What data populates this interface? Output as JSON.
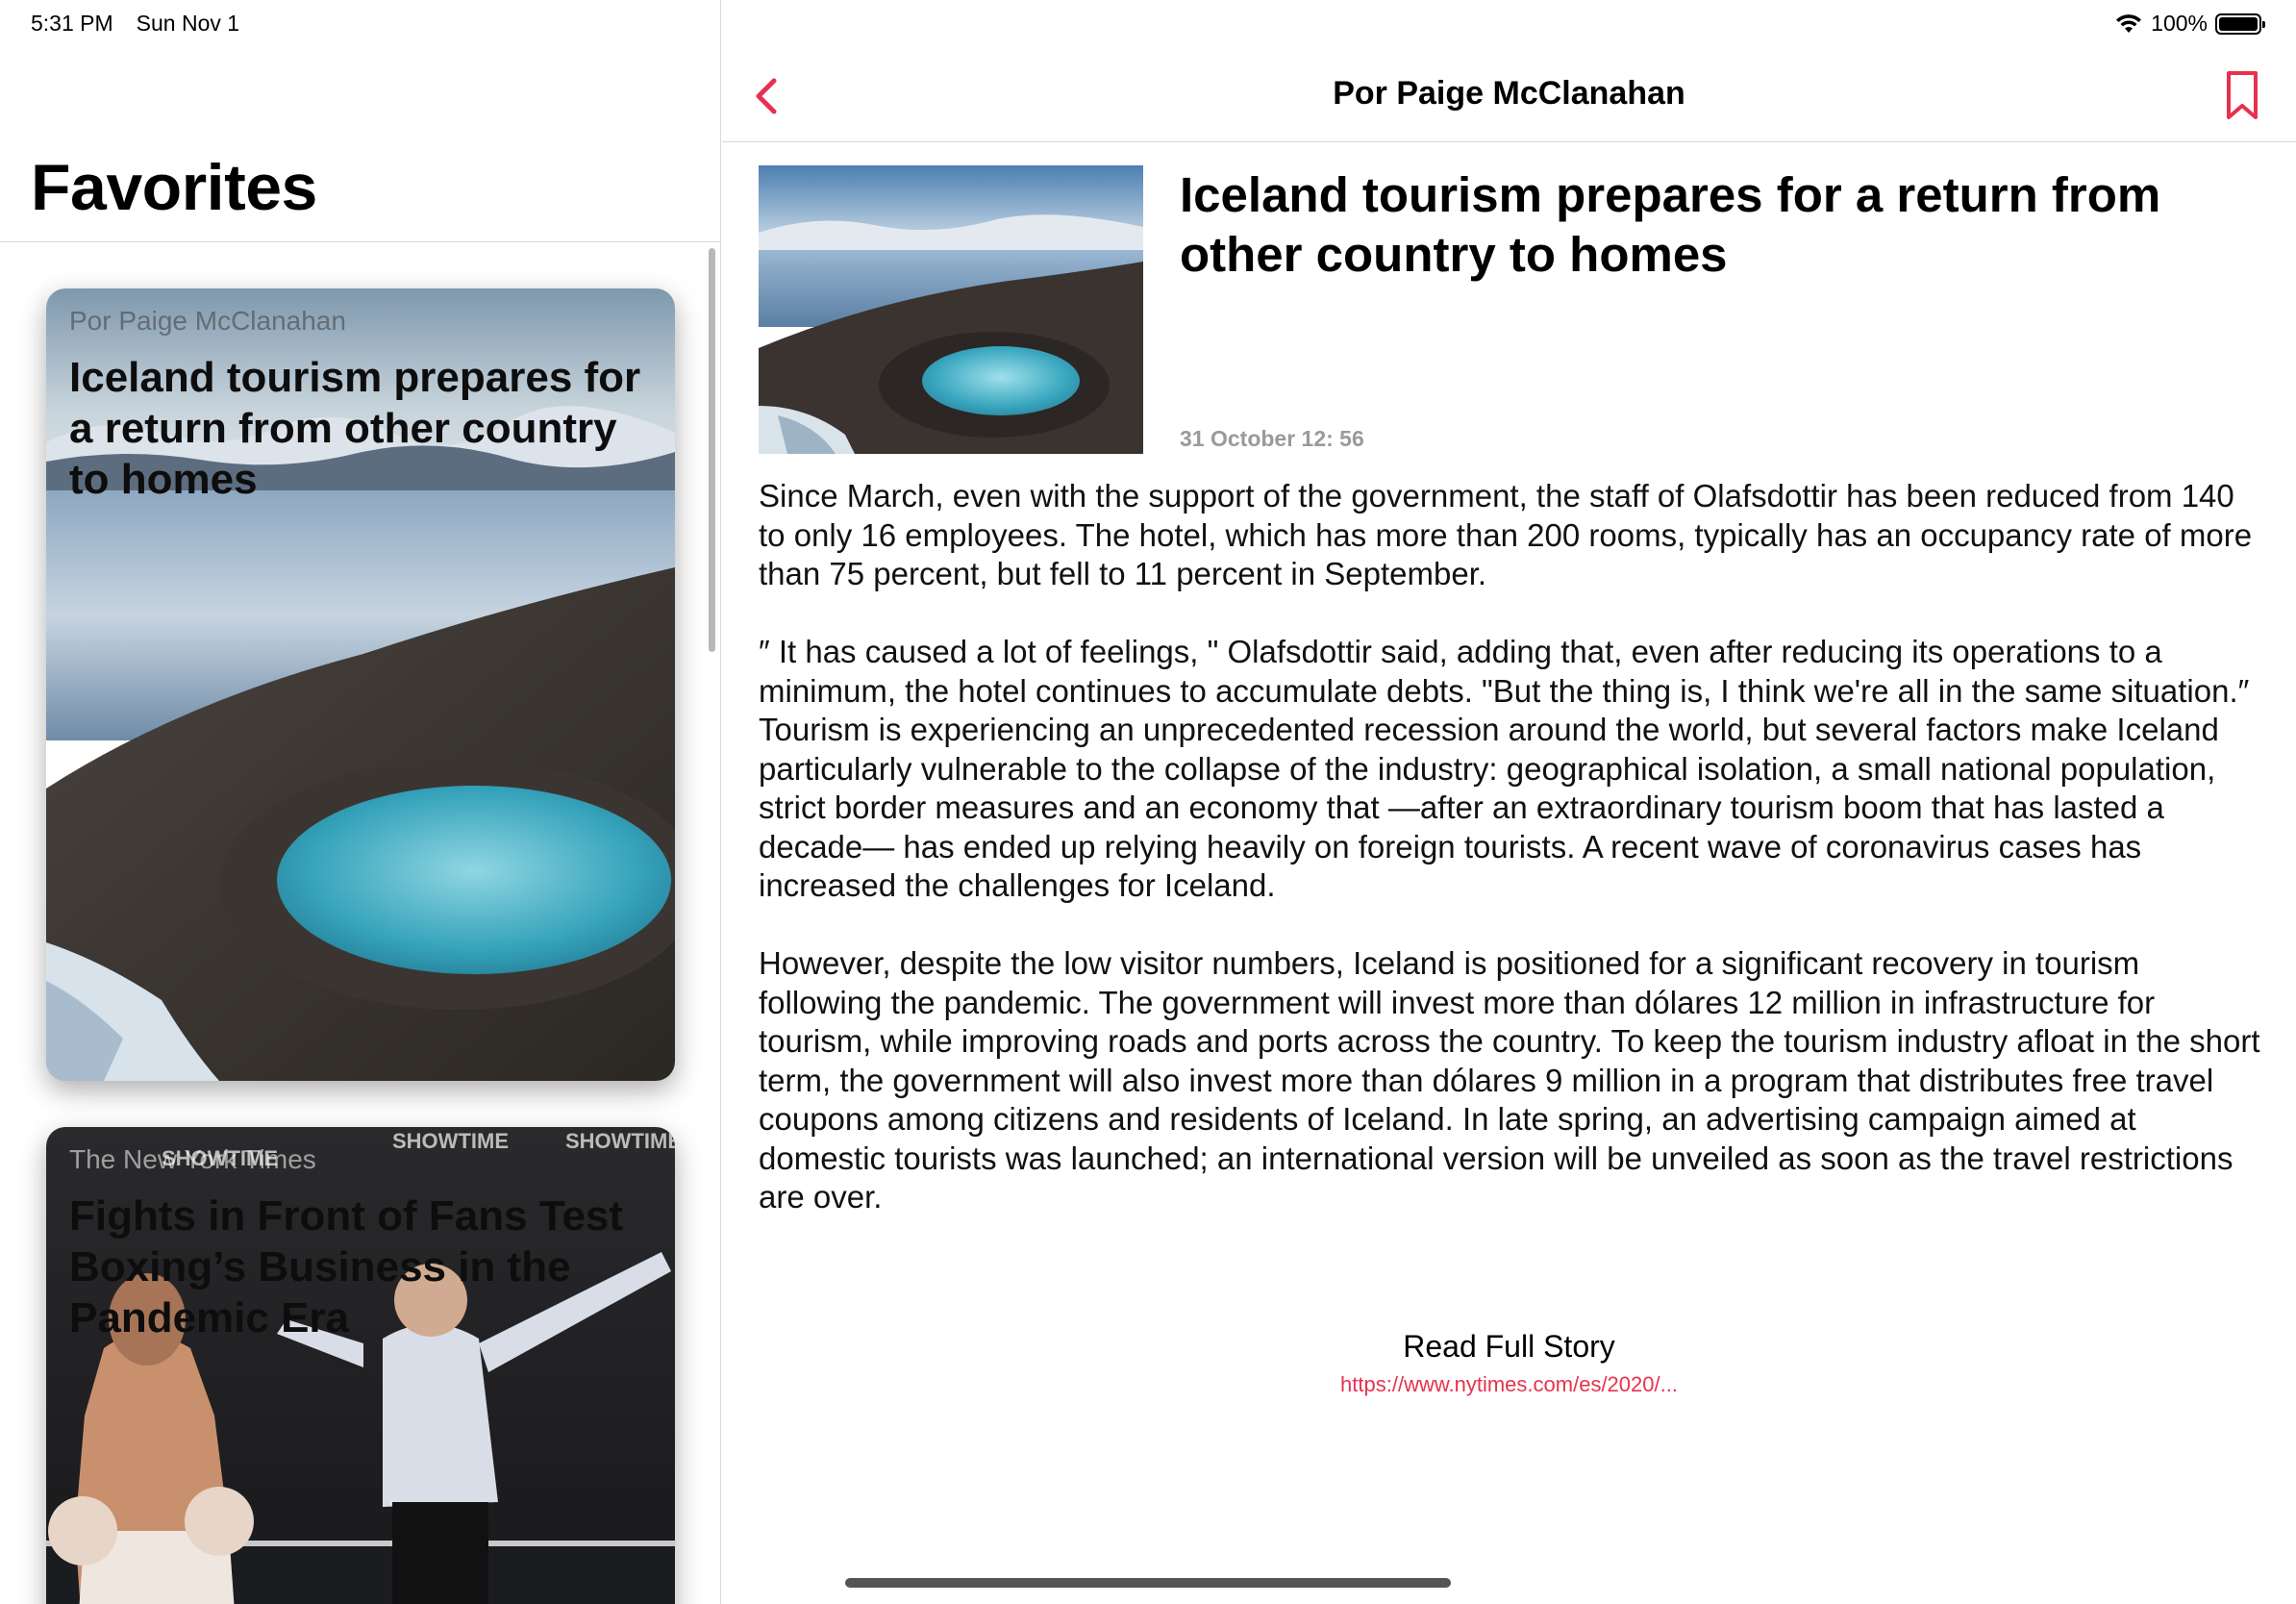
{
  "status_bar": {
    "time": "5:31 PM",
    "date": "Sun Nov 1",
    "battery": "100%",
    "icons": [
      "wifi-icon",
      "battery-icon"
    ]
  },
  "sidebar": {
    "title": "Favorites",
    "cards": [
      {
        "source": "Por Paige McClanahan",
        "title": "Iceland tourism prepares for a return from other country to homes"
      },
      {
        "source": "The New York Times",
        "title": "Fights in Front of Fans Test Boxing’s Business in the Pandemic Era"
      }
    ]
  },
  "nav": {
    "title": "Por Paige McClanahan",
    "back_icon": "chevron-left-icon",
    "bookmark_icon": "bookmark-icon"
  },
  "article": {
    "title": "Iceland tourism prepares for a return from other country to homes",
    "date": "31 October 12: 56",
    "paragraphs": [
      "Since March, even with the support of the government, the staff of Olafsdottir has been reduced from 140 to only 16 employees. The hotel, which has more than 200 rooms, typically has an occupancy rate of more than 75 percent, but fell to 11 percent in September.",
      "″ It has caused a lot of feelings, \" Olafsdottir said, adding that, even after reducing its operations to a minimum, the hotel continues to accumulate debts. \"But the thing is, I think we're all in the same situation.″",
      "Tourism is experiencing an unprecedented recession around the world, but several factors make Iceland particularly vulnerable to the collapse of the industry: geographical isolation, a small national population, strict border measures and an economy that —after an extraordinary tourism boom that has lasted a decade— has ended up relying heavily on foreign tourists. A recent wave of coronavirus cases has increased the challenges for Iceland.",
      "However, despite the low visitor numbers, Iceland is positioned for a significant recovery in tourism following the pandemic. The government will invest more than dólares 12 million in infrastructure for tourism, while improving roads and ports across the country. To keep the tourism industry afloat in the short term, the government will also invest more than dólares 9 million in a program that distributes free travel coupons among citizens and residents of Iceland. In late spring, an advertising campaign aimed at domestic tourists was launched; an international version will be unveiled as soon as the travel restrictions are over."
    ],
    "read_full_label": "Read Full Story",
    "read_full_url": "https://www.nytimes.com/es/2020/..."
  },
  "colors": {
    "accent": "#e8314f",
    "separator": "#d8d8d8",
    "date_gray": "#9a9a9a"
  }
}
